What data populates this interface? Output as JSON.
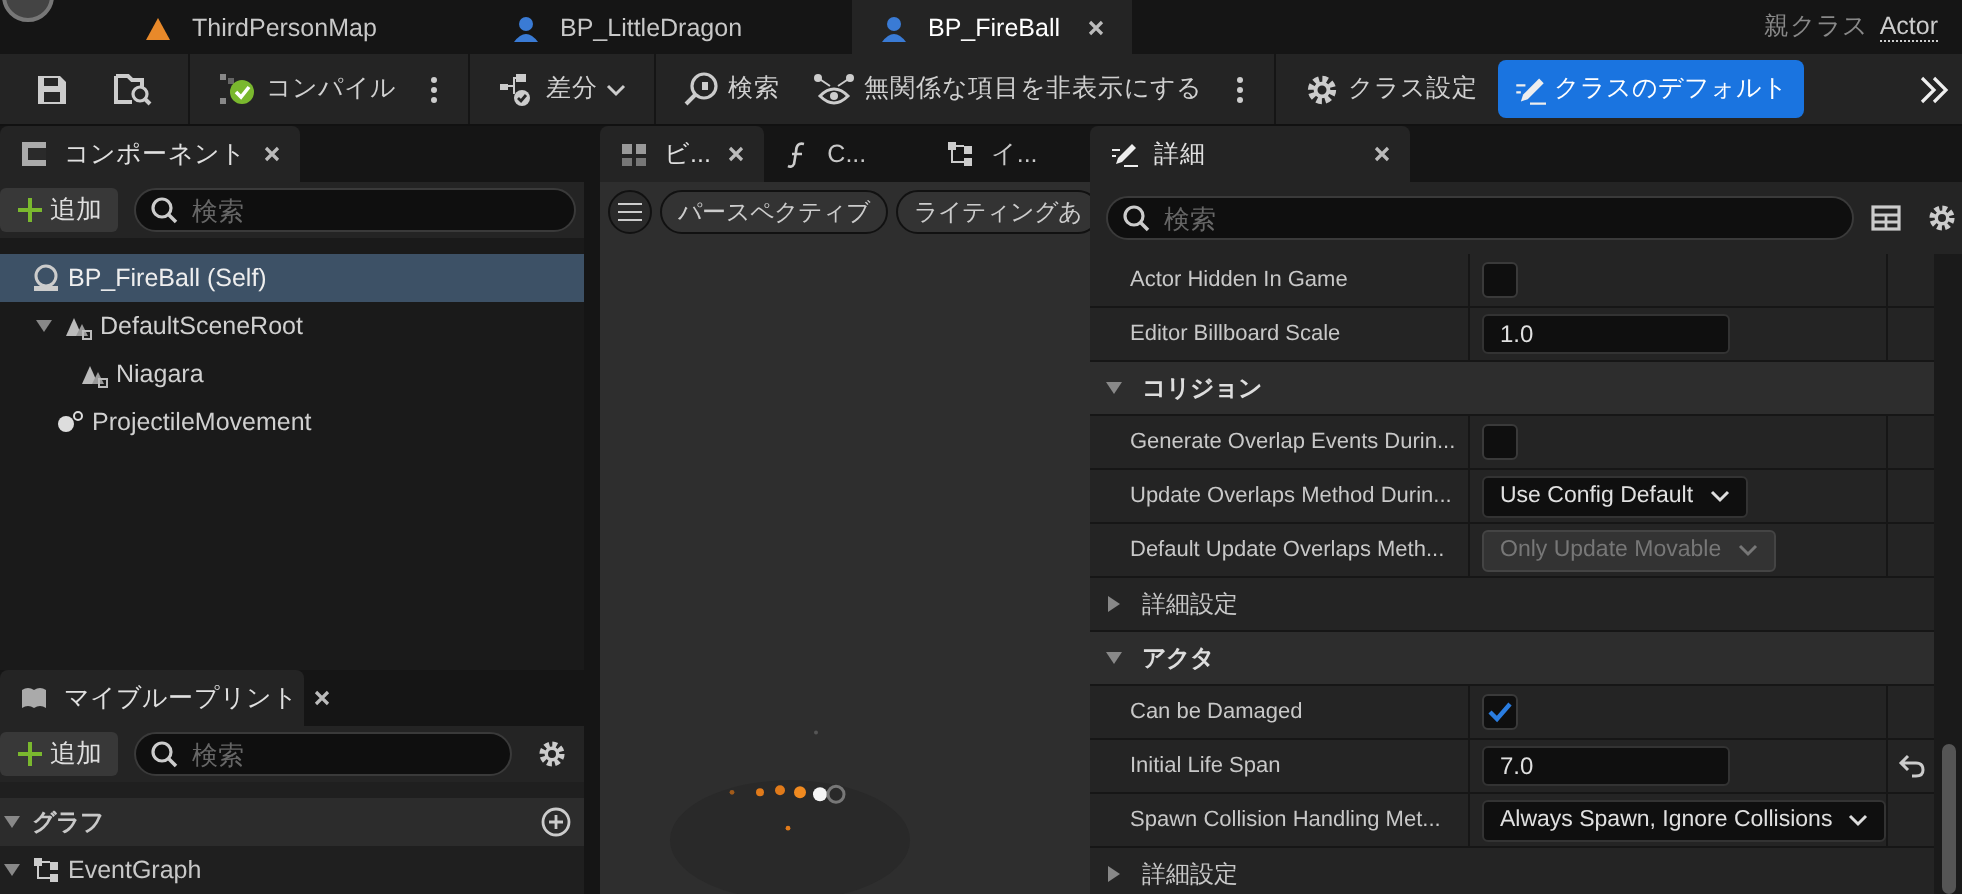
{
  "doc_tabs": [
    {
      "label": "ThirdPersonMap",
      "kind": "map",
      "selected": false
    },
    {
      "label": "BP_LittleDragon",
      "kind": "blueprint",
      "selected": false
    },
    {
      "label": "BP_FireBall",
      "kind": "blueprint",
      "selected": true
    }
  ],
  "parent_class": {
    "label": "親クラス",
    "value": "Actor"
  },
  "toolbar": {
    "compile": "コンパイル",
    "diff": "差分",
    "find": "検索",
    "hide_unrelated": "無関係な項目を非表示にする",
    "class_settings": "クラス設定",
    "class_defaults": {
      "label": "クラスのデフォルト",
      "selected": true
    }
  },
  "components": {
    "title": "コンポーネント",
    "add": "追加",
    "search_placeholder": "検索",
    "tree": [
      {
        "label": "BP_FireBall (Self)",
        "kind": "self",
        "selected": true,
        "children": [
          {
            "label": "DefaultSceneRoot",
            "kind": "scene",
            "selected": false,
            "expanded": true,
            "children": [
              {
                "label": "Niagara",
                "kind": "scene",
                "selected": false
              }
            ]
          },
          {
            "label": "ProjectileMovement",
            "kind": "movement",
            "selected": false
          }
        ]
      }
    ]
  },
  "viewport_tabs": [
    {
      "label": "ビ...",
      "kind": "viewport",
      "selected": true
    },
    {
      "label": "C...",
      "kind": "function",
      "selected": false
    },
    {
      "label": "イ...",
      "kind": "graph",
      "selected": false
    }
  ],
  "viewport_toolbar": [
    "パースペクティブ",
    "ライティングあ"
  ],
  "my_blueprint": {
    "title": "マイブループリント",
    "add": "追加",
    "search_placeholder": "検索",
    "sections": [
      {
        "label": "グラフ",
        "expanded": true,
        "items": [
          {
            "label": "EventGraph",
            "expanded": true
          }
        ]
      }
    ]
  },
  "details": {
    "title": "詳細",
    "search_placeholder": "検索",
    "rows": [
      {
        "kind": "checkbox",
        "label": "Actor Hidden In Game",
        "checked": false
      },
      {
        "kind": "number",
        "label": "Editor Billboard Scale",
        "value": "1.0"
      },
      {
        "kind": "category",
        "label": "コリジョン",
        "expanded": true
      },
      {
        "kind": "checkbox",
        "label": "Generate Overlap Events Durin...",
        "checked": false
      },
      {
        "kind": "dropdown",
        "label": "Update Overlaps Method Durin...",
        "value": "Use Config Default",
        "disabled": false
      },
      {
        "kind": "dropdown",
        "label": "Default Update Overlaps Meth...",
        "value": "Only Update Movable",
        "disabled": true
      },
      {
        "kind": "advanced",
        "label": "詳細設定",
        "expanded": false
      },
      {
        "kind": "category",
        "label": "アクタ",
        "expanded": true
      },
      {
        "kind": "checkbox",
        "label": "Can be Damaged",
        "checked": true
      },
      {
        "kind": "number",
        "label": "Initial Life Span",
        "value": "7.0",
        "modified": true
      },
      {
        "kind": "dropdown",
        "label": "Spawn Collision Handling Met...",
        "value": "Always Spawn, Ignore Collisions",
        "disabled": false
      },
      {
        "kind": "advanced",
        "label": "詳細設定",
        "expanded": false
      }
    ]
  }
}
